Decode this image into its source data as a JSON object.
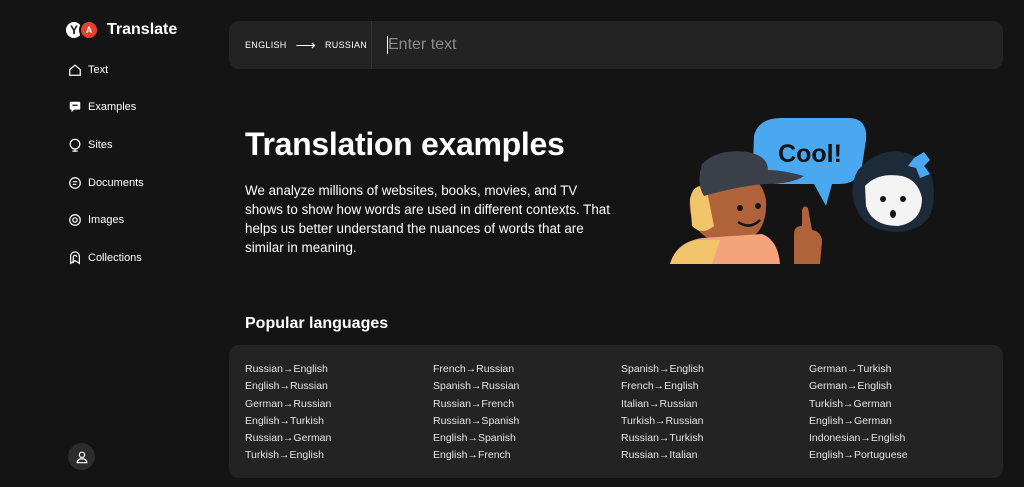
{
  "app": {
    "title": "Translate"
  },
  "sidebar": {
    "items": [
      {
        "label": "Text",
        "icon": "home-icon"
      },
      {
        "label": "Examples",
        "icon": "examples-icon"
      },
      {
        "label": "Sites",
        "icon": "globe-icon"
      },
      {
        "label": "Documents",
        "icon": "document-icon"
      },
      {
        "label": "Images",
        "icon": "image-icon"
      },
      {
        "label": "Collections",
        "icon": "bookmark-icon"
      }
    ]
  },
  "search": {
    "source_lang": "ENGLISH",
    "arrow": "⟶",
    "target_lang": "RUSSIAN",
    "placeholder": "Enter text",
    "value": ""
  },
  "hero": {
    "title": "Translation examples",
    "description": "We analyze millions of websites, books, movies, and TV shows to show how words are used in different contexts. That helps us better understand the nuances of words that are similar in meaning.",
    "bubble_text": "Cool!"
  },
  "popular": {
    "title": "Popular languages",
    "columns": [
      [
        "Russian→English",
        "English→Russian",
        "German→Russian",
        "English→Turkish",
        "Russian→German",
        "Turkish→English"
      ],
      [
        "French→Russian",
        "Spanish→Russian",
        "Russian→French",
        "Russian→Spanish",
        "English→Spanish",
        "English→French"
      ],
      [
        "Spanish→English",
        "French→English",
        "Italian→Russian",
        "Turkish→Russian",
        "Russian→Turkish",
        "Russian→Italian"
      ],
      [
        "German→Turkish",
        "German→English",
        "Turkish→German",
        "English→German",
        "Indonesian→English",
        "English→Portuguese"
      ]
    ]
  },
  "colors": {
    "background": "#141414",
    "panel": "#232323",
    "bubble": "#4aa8f0",
    "accent": "#e8402c"
  }
}
